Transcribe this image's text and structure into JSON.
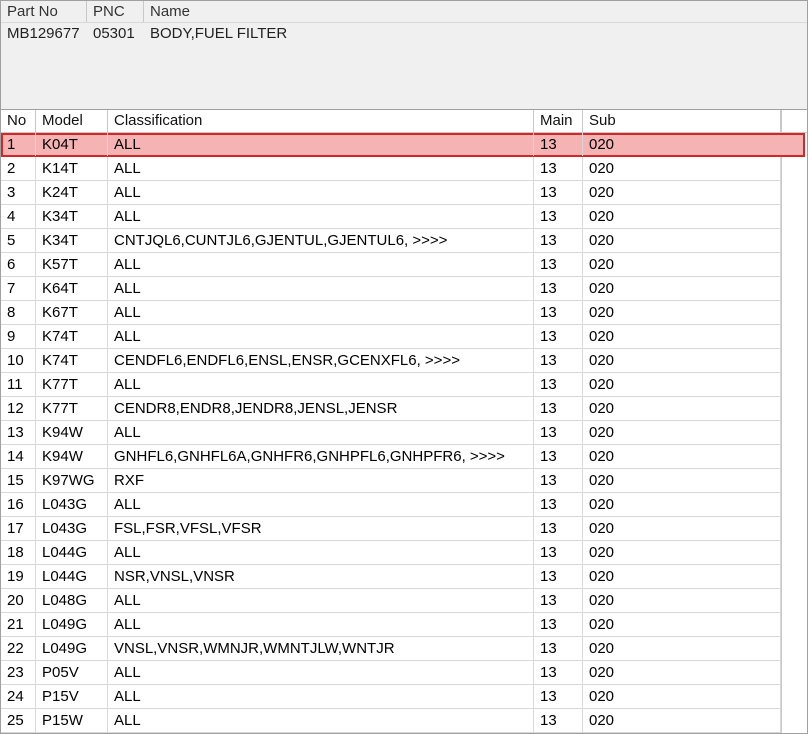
{
  "top": {
    "headers": [
      "Part No",
      "PNC",
      "Name"
    ],
    "row": {
      "part_no": "MB129677",
      "pnc": "05301",
      "name": "BODY,FUEL FILTER"
    }
  },
  "grid": {
    "headers": [
      "No",
      "Model",
      "Classification",
      "Main",
      "Sub"
    ],
    "selected_index": 0,
    "selection_color": "#f6b3b3",
    "selection_border": "#d32626",
    "rows": [
      {
        "no": "1",
        "model": "K04T",
        "classification": "ALL",
        "main": "13",
        "sub": "020"
      },
      {
        "no": "2",
        "model": "K14T",
        "classification": "ALL",
        "main": "13",
        "sub": "020"
      },
      {
        "no": "3",
        "model": "K24T",
        "classification": "ALL",
        "main": "13",
        "sub": "020"
      },
      {
        "no": "4",
        "model": "K34T",
        "classification": "ALL",
        "main": "13",
        "sub": "020"
      },
      {
        "no": "5",
        "model": "K34T",
        "classification": "CNTJQL6,CUNTJL6,GJENTUL,GJENTUL6,  >>>>",
        "main": "13",
        "sub": "020"
      },
      {
        "no": "6",
        "model": "K57T",
        "classification": "ALL",
        "main": "13",
        "sub": "020"
      },
      {
        "no": "7",
        "model": "K64T",
        "classification": "ALL",
        "main": "13",
        "sub": "020"
      },
      {
        "no": "8",
        "model": "K67T",
        "classification": "ALL",
        "main": "13",
        "sub": "020"
      },
      {
        "no": "9",
        "model": "K74T",
        "classification": "ALL",
        "main": "13",
        "sub": "020"
      },
      {
        "no": "10",
        "model": "K74T",
        "classification": "CENDFL6,ENDFL6,ENSL,ENSR,GCENXFL6,  >>>>",
        "main": "13",
        "sub": "020"
      },
      {
        "no": "11",
        "model": "K77T",
        "classification": "ALL",
        "main": "13",
        "sub": "020"
      },
      {
        "no": "12",
        "model": "K77T",
        "classification": "CENDR8,ENDR8,JENDR8,JENSL,JENSR",
        "main": "13",
        "sub": "020"
      },
      {
        "no": "13",
        "model": "K94W",
        "classification": "ALL",
        "main": "13",
        "sub": "020"
      },
      {
        "no": "14",
        "model": "K94W",
        "classification": "GNHFL6,GNHFL6A,GNHFR6,GNHPFL6,GNHPFR6,  >>>>",
        "main": "13",
        "sub": "020"
      },
      {
        "no": "15",
        "model": "K97WG",
        "classification": "RXF",
        "main": "13",
        "sub": "020"
      },
      {
        "no": "16",
        "model": "L043G",
        "classification": "ALL",
        "main": "13",
        "sub": "020"
      },
      {
        "no": "17",
        "model": "L043G",
        "classification": "FSL,FSR,VFSL,VFSR",
        "main": "13",
        "sub": "020"
      },
      {
        "no": "18",
        "model": "L044G",
        "classification": "ALL",
        "main": "13",
        "sub": "020"
      },
      {
        "no": "19",
        "model": "L044G",
        "classification": "NSR,VNSL,VNSR",
        "main": "13",
        "sub": "020"
      },
      {
        "no": "20",
        "model": "L048G",
        "classification": "ALL",
        "main": "13",
        "sub": "020"
      },
      {
        "no": "21",
        "model": "L049G",
        "classification": "ALL",
        "main": "13",
        "sub": "020"
      },
      {
        "no": "22",
        "model": "L049G",
        "classification": "VNSL,VNSR,WMNJR,WMNTJLW,WNTJR",
        "main": "13",
        "sub": "020"
      },
      {
        "no": "23",
        "model": "P05V",
        "classification": "ALL",
        "main": "13",
        "sub": "020"
      },
      {
        "no": "24",
        "model": "P15V",
        "classification": "ALL",
        "main": "13",
        "sub": "020"
      },
      {
        "no": "25",
        "model": "P15W",
        "classification": "ALL",
        "main": "13",
        "sub": "020"
      }
    ]
  }
}
